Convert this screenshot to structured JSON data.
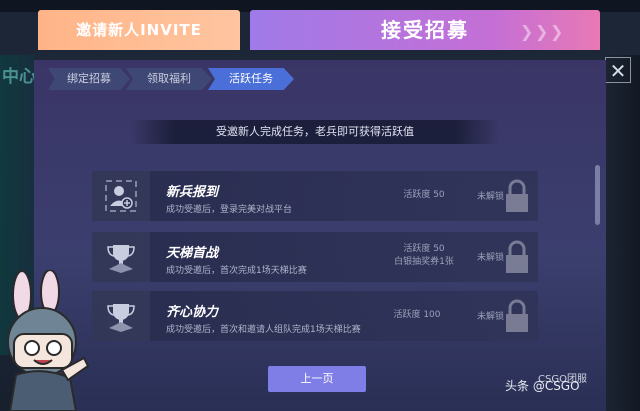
{
  "header": {
    "tab_invite": "邀请新人INVITE",
    "tab_accept": "接受招募"
  },
  "steps": [
    "绑定招募",
    "领取福利",
    "活跃任务"
  ],
  "active_step": 2,
  "info_text": "受邀新人完成任务，老兵即可获得活跃值",
  "tasks": [
    {
      "title": "新兵报到",
      "desc": "成功受邀后，登录完美对战平台",
      "points": "活跃度 50",
      "extra": "",
      "status": "未解锁",
      "icon": "user-add-icon"
    },
    {
      "title": "天梯首战",
      "desc": "成功受邀后，首次完成1场天梯比赛",
      "points": "活跃度 50",
      "extra": "白银抽奖券1张",
      "status": "未解锁",
      "icon": "trophy-icon"
    },
    {
      "title": "齐心协力",
      "desc": "成功受邀后，首次和邀请人组队完成1场天梯比赛",
      "points": "活跃度 100",
      "extra": "",
      "status": "未解锁",
      "icon": "trophy-icon"
    }
  ],
  "prev_button": "上一页",
  "watermark": "头条 @CSGO",
  "watermark_top": "CSGO团服",
  "close_icon": "close-icon"
}
